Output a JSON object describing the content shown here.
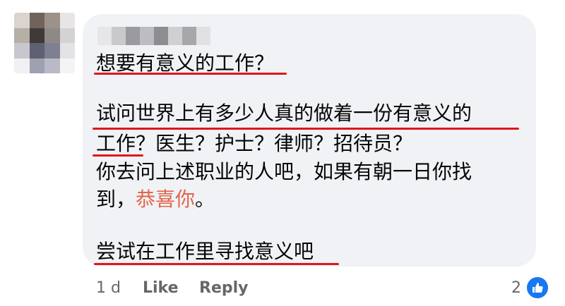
{
  "comment": {
    "author_name_blurred": "",
    "lines": [
      "想要有意义的工作？",
      "试问世界上有多少人真的做着一份有意义的",
      "工作？医生？护士？律师？招待员？",
      "你去问上述职业的人吧，如果有朝一日你找",
      "到，",
      "恭喜你",
      "。",
      "尝试在工作里寻找意义吧"
    ],
    "highlight_color": "#e4654a",
    "underline_color": "#e0161b"
  },
  "actions": {
    "time": "1 d",
    "like": "Like",
    "reply": "Reply",
    "reaction_count": "2",
    "reaction_icon": "thumbs-up-icon"
  },
  "colors": {
    "bubble": "#f0f2f5",
    "meta_text": "#65676b",
    "like_blue": "#1877f2"
  }
}
